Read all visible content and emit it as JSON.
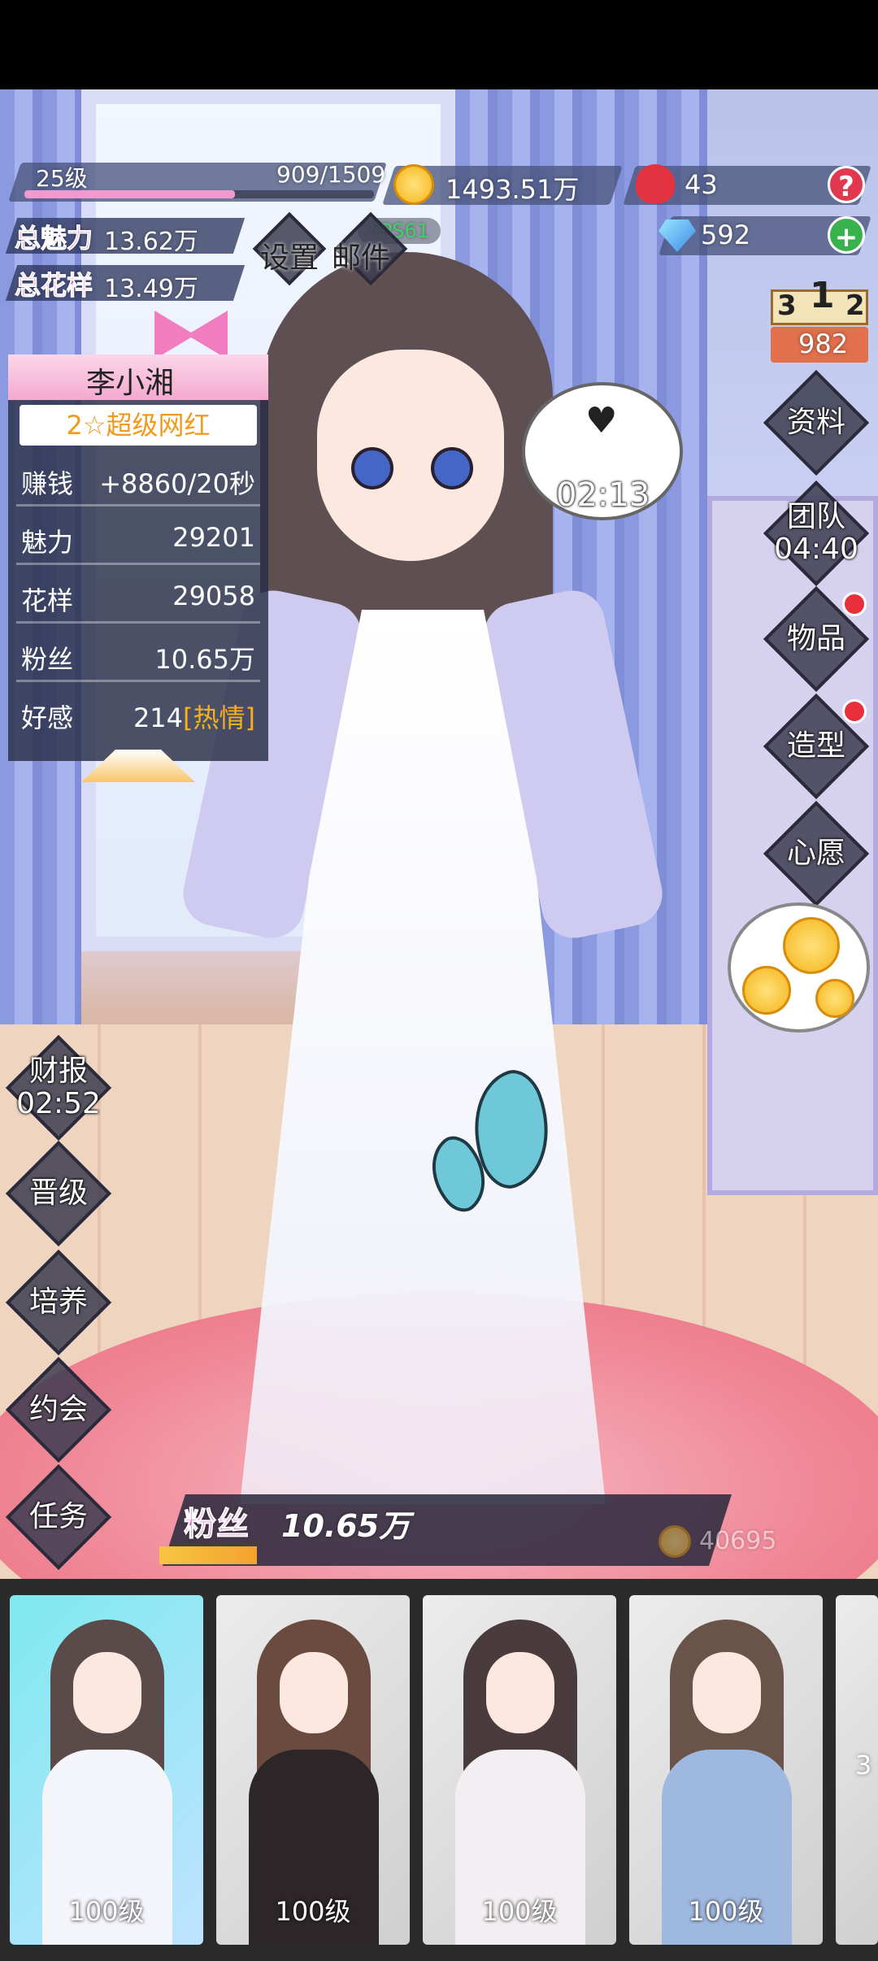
{
  "hud": {
    "level": "25级",
    "exp": "909/1509",
    "exp_progress": 0.602,
    "coins": "1493.51万",
    "roses": "43",
    "diamonds": "592",
    "charm_label": "总魅力",
    "charm_value": "13.62万",
    "style_label": "总花样",
    "style_value": "13.49万",
    "fps": "FPS61",
    "settings_label": "设置",
    "mail_label": "邮件",
    "help_symbol": "?",
    "add_symbol": "+"
  },
  "ranking": {
    "places": [
      "3",
      "1",
      "2"
    ],
    "score": "982"
  },
  "character": {
    "name": "李小湘",
    "rank": "2☆超级网红",
    "stats": [
      {
        "label": "赚钱",
        "value": "+8860/20秒"
      },
      {
        "label": "魅力",
        "value": "29201"
      },
      {
        "label": "花样",
        "value": "29058"
      },
      {
        "label": "粉丝",
        "value": "10.65万"
      }
    ],
    "affection_label": "好感",
    "affection_value": "214",
    "affection_status": "[热情]"
  },
  "bubble": {
    "timer": "02:13"
  },
  "right_menu": [
    {
      "label": "资料",
      "timer": ""
    },
    {
      "label": "团队",
      "timer": "04:40"
    },
    {
      "label": "物品",
      "timer": ""
    },
    {
      "label": "造型",
      "timer": ""
    },
    {
      "label": "心愿",
      "timer": ""
    }
  ],
  "left_menu": [
    {
      "label": "财报",
      "timer": "02:52"
    },
    {
      "label": "晋级",
      "timer": ""
    },
    {
      "label": "培养",
      "timer": ""
    },
    {
      "label": "约会",
      "timer": ""
    },
    {
      "label": "任务",
      "timer": ""
    }
  ],
  "fans": {
    "label": "粉丝",
    "value": "10.65万",
    "side_value": "40695",
    "progress": 0.2
  },
  "outfits": [
    {
      "level": "100级"
    },
    {
      "level": "100级"
    },
    {
      "level": "100级"
    },
    {
      "level": "100级"
    }
  ],
  "partial_text": "3",
  "colors": {
    "accent_pink": "#d35ab8",
    "gold": "#f5b41b",
    "panel": "#282d46"
  }
}
